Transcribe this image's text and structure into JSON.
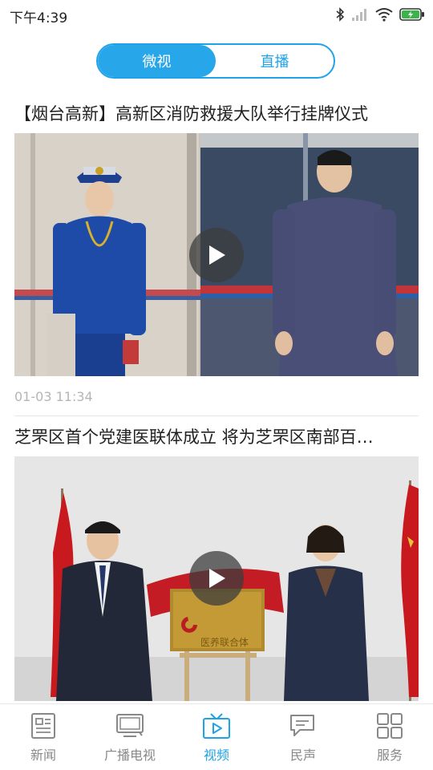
{
  "status": {
    "time": "下午4:39"
  },
  "segment": {
    "tabs": [
      "微视",
      "直播"
    ],
    "active": 0
  },
  "feed": [
    {
      "title": "【烟台高新】高新区消防救援大队举行挂牌仪式",
      "time": "01-03 11:34"
    },
    {
      "title": "芝罘区首个党建医联体成立 将为芝罘区南部百…",
      "plaque": "医养联合体"
    }
  ],
  "tabbar": {
    "items": [
      {
        "label": "新闻",
        "icon": "news-icon"
      },
      {
        "label": "广播电视",
        "icon": "tv-icon"
      },
      {
        "label": "视频",
        "icon": "video-icon"
      },
      {
        "label": "民声",
        "icon": "chat-icon"
      },
      {
        "label": "服务",
        "icon": "grid-icon"
      }
    ],
    "active": 2
  },
  "colors": {
    "accent": "#1fa3e8",
    "muted": "#888888"
  }
}
